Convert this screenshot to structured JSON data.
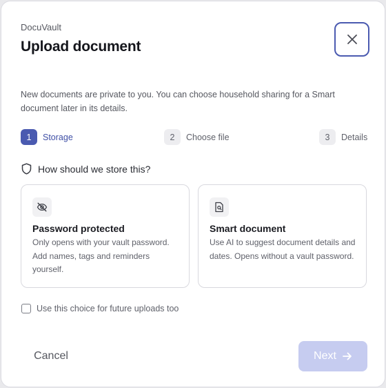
{
  "app_name": "DocuVault",
  "title": "Upload document",
  "description": "New documents are private to you. You can choose household sharing for a Smart document later in its details.",
  "steps": [
    {
      "number": "1",
      "label": "Storage",
      "active": true
    },
    {
      "number": "2",
      "label": "Choose file",
      "active": false
    },
    {
      "number": "3",
      "label": "Details",
      "active": false
    }
  ],
  "section": {
    "title": "How should we store this?",
    "icon": "shield-icon"
  },
  "options": [
    {
      "title": "Password protected",
      "description": "Only opens with your vault password. Add names, tags and reminders yourself.",
      "icon": "eye-off-icon"
    },
    {
      "title": "Smart document",
      "description": "Use AI to suggest document details and dates. Opens without a vault password.",
      "icon": "document-search-icon"
    }
  ],
  "remember_label": "Use this choice for future uploads too",
  "remember_checked": false,
  "buttons": {
    "cancel": "Cancel",
    "next": "Next",
    "close": "close-icon"
  },
  "colors": {
    "accent": "#4a5ab0",
    "next_disabled_bg": "#c6ccf0"
  }
}
